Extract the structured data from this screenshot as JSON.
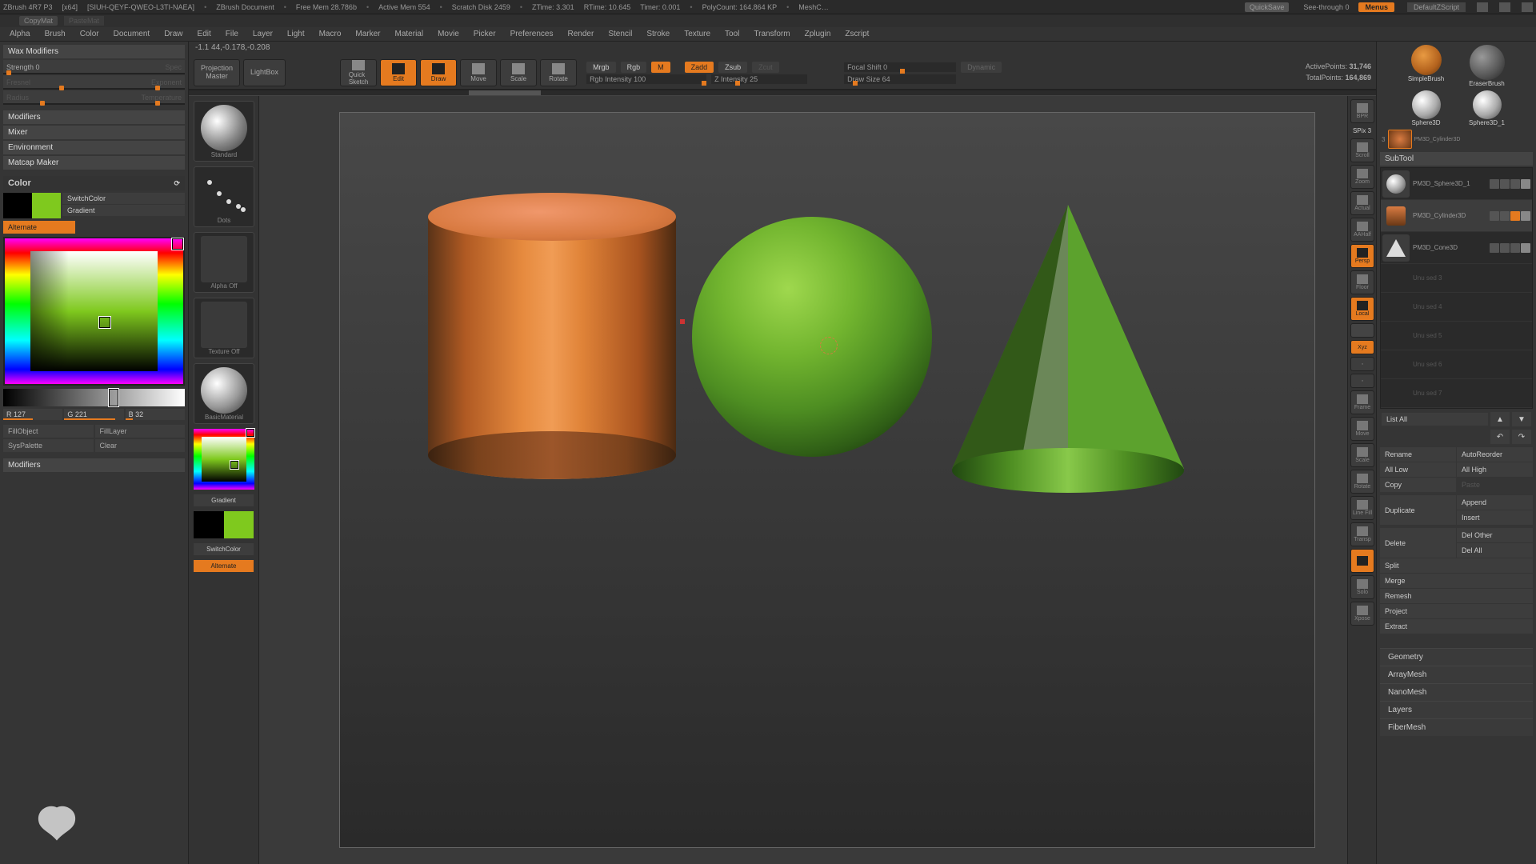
{
  "title": {
    "app": "ZBrush 4R7 P3",
    "arch": "[x64]",
    "session": "[SIUH-QEYF-QWEO-L3TI-NAEA]",
    "doc": "ZBrush Document",
    "freemem": "Free Mem 28.786b",
    "activemem": "Active Mem 554",
    "scratch": "Scratch Disk 2459",
    "ztime": "ZTime: 3.301",
    "rtime": "RTime: 10.645",
    "timer": "Timer: 0.001",
    "polycount": "PolyCount: 164.864 KP",
    "meshc": "MeshC…",
    "quicksave": "QuickSave",
    "seethrough": "See-through   0",
    "menus": "Menus",
    "defscript": "DefaultZScript"
  },
  "menubar": [
    "Alpha",
    "Brush",
    "Color",
    "Document",
    "Draw",
    "Edit",
    "File",
    "Layer",
    "Light",
    "Macro",
    "Marker",
    "Material",
    "Movie",
    "Picker",
    "Preferences",
    "Render",
    "Stencil",
    "Stroke",
    "Texture",
    "Tool",
    "Transform",
    "Zplugin",
    "Zscript"
  ],
  "sys": {
    "copymat": "CopyMat",
    "pastemat": "PasteMat"
  },
  "coord": "-1.1 44,-0.178,-0.208",
  "toolbar": {
    "proj": "Projection\nMaster",
    "lightbox": "LightBox",
    "quicksketch": "Quick\nSketch",
    "edit": "Edit",
    "draw": "Draw",
    "move": "Move",
    "scale": "Scale",
    "rotate": "Rotate",
    "mrgb": "Mrgb",
    "rgb": "Rgb",
    "m": "M",
    "zadd": "Zadd",
    "zsub": "Zsub",
    "zcut": "Zcut",
    "rgbint": "Rgb Intensity 100",
    "zint": "Z Intensity 25",
    "focal": "Focal Shift 0",
    "drawsize": "Draw Size 64",
    "dynamic": "Dynamic",
    "active": "ActivePoints:",
    "active_v": "31,746",
    "total": "TotalPoints:",
    "total_v": "164,869"
  },
  "left": {
    "wax": "Wax Modifiers",
    "strength": "Strength 0",
    "spec": "Spec",
    "fresnel": "Fresnel",
    "exponent": "Exponent",
    "radius": "Radius",
    "temperature": "Temperature",
    "mods": "Modifiers",
    "mixer": "Mixer",
    "env": "Environment",
    "matcap": "Matcap Maker",
    "color_hdr": "Color",
    "switchcolor": "SwitchColor",
    "gradient": "Gradient",
    "alternate": "Alternate",
    "r": "R 127",
    "g": "G 221",
    "b": "B  32",
    "fillobj": "FillObject",
    "filllayer": "FillLayer",
    "syspal": "SysPalette",
    "clear": "Clear",
    "mods2": "Modifiers"
  },
  "brushcol": {
    "standard": "Standard",
    "dots": "Dots",
    "alpha": "Alpha  Off",
    "texture": "Texture  Off",
    "material": "BasicMaterial",
    "gradient": "Gradient",
    "switchcolor": "SwitchColor",
    "alternate": "Alternate"
  },
  "vstrip": [
    "BPR",
    "Scroll",
    "Zoom",
    "Actual",
    "AAHalf",
    "Persp",
    "Floor",
    "Local",
    "Xyz",
    "",
    "",
    "Frame",
    "Move",
    "Scale",
    "Rotate",
    "Line Fill",
    "",
    "Transp",
    "",
    "Solo",
    "Xpose"
  ],
  "spix": "SPix 3",
  "right": {
    "simple": "SimpleBrush",
    "eraser": "EraserBrush",
    "sphere": "Sphere3D",
    "sphere1": "Sphere3D_1",
    "cyl": "PM3D_Cylinder3D",
    "subtool": "SubTool",
    "st1": "PM3D_Sphere3D_1",
    "st2": "PM3D_Cylinder3D",
    "st3": "PM3D_Cone3D",
    "empty": [
      "Unu sed  3",
      "Unu sed  4",
      "Unu sed  5",
      "Unu sed  6",
      "Unu sed  7"
    ],
    "listall": "List All",
    "rename": "Rename",
    "autoreorder": "AutoReorder",
    "alllow": "All Low",
    "allhigh": "All High",
    "copy": "Copy",
    "paste": "Paste",
    "duplicate": "Duplicate",
    "append": "Append",
    "insert": "Insert",
    "delete": "Delete",
    "delother": "Del Other",
    "delall": "Del All",
    "split": "Split",
    "merge": "Merge",
    "remesh": "Remesh",
    "project": "Project",
    "extract": "Extract",
    "acc": [
      "Geometry",
      "ArrayMesh",
      "NanoMesh",
      "Layers",
      "FiberMesh"
    ]
  }
}
